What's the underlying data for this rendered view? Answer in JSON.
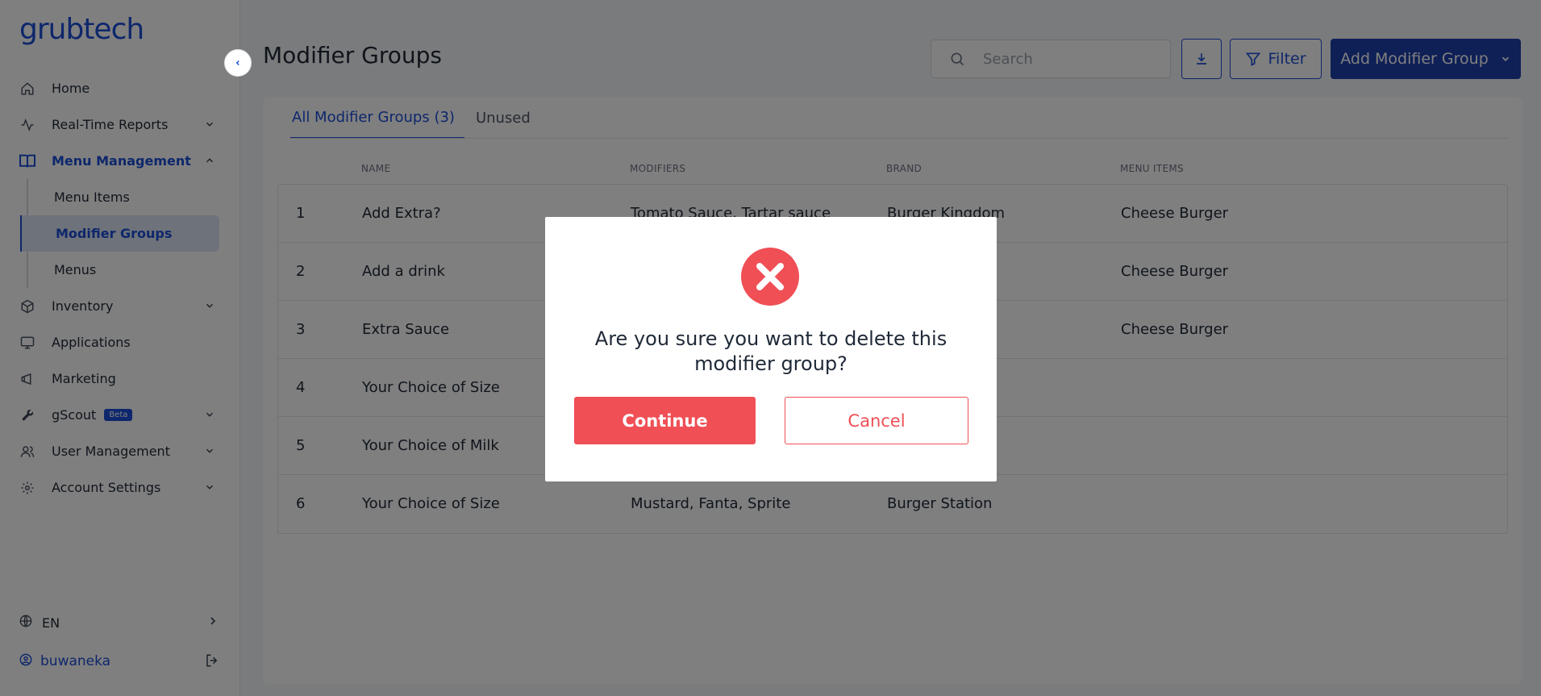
{
  "app": {
    "logo": "grubtech"
  },
  "sidebar": {
    "items": [
      {
        "label": "Home",
        "icon": "home-icon"
      },
      {
        "label": "Real-Time Reports",
        "icon": "activity-icon"
      },
      {
        "label": "Menu Management",
        "icon": "book-icon"
      },
      {
        "label": "Inventory",
        "icon": "box-icon"
      },
      {
        "label": "Applications",
        "icon": "monitor-icon"
      },
      {
        "label": "Marketing",
        "icon": "megaphone-icon"
      },
      {
        "label": "gScout",
        "icon": "wrench-icon",
        "badge": "Beta"
      },
      {
        "label": "User Management",
        "icon": "users-icon"
      },
      {
        "label": "Account Settings",
        "icon": "gear-icon"
      }
    ],
    "menu_management_sub": [
      {
        "label": "Menu Items"
      },
      {
        "label": "Modifier Groups"
      },
      {
        "label": "Menus"
      }
    ],
    "language": "EN",
    "username": "buwaneka"
  },
  "header": {
    "title": "Modifier Groups",
    "search_placeholder": "Search",
    "filter_label": "Filter",
    "add_label": "Add Modifier Group"
  },
  "tabs": [
    {
      "label": "All Modifier Groups (3)"
    },
    {
      "label": "Unused"
    }
  ],
  "table": {
    "columns": {
      "name": "NAME",
      "modifiers": "MODIFIERS",
      "brand": "BRAND",
      "menu_items": "MENU ITEMS"
    },
    "rows": [
      {
        "num": "1",
        "name": "Add Extra?",
        "modifiers": "Tomato Sauce, Tartar sauce",
        "brand": "Burger Kingdom",
        "menu_items": "Cheese Burger"
      },
      {
        "num": "2",
        "name": "Add a drink",
        "modifiers": "",
        "brand": "",
        "menu_items": "Cheese Burger"
      },
      {
        "num": "3",
        "name": "Extra Sauce",
        "modifiers": "",
        "brand": "",
        "menu_items": "Cheese Burger"
      },
      {
        "num": "4",
        "name": "Your Choice of Size",
        "modifiers": "",
        "brand": "",
        "menu_items": ""
      },
      {
        "num": "5",
        "name": "Your Choice of Milk",
        "modifiers": "",
        "brand": "",
        "menu_items": ""
      },
      {
        "num": "6",
        "name": "Your Choice of Size",
        "modifiers": "Mustard, Fanta, Sprite",
        "brand": "Burger Station",
        "menu_items": ""
      }
    ]
  },
  "modal": {
    "message": "Are you sure you want to delete this modifier group?",
    "continue_label": "Continue",
    "cancel_label": "Cancel"
  },
  "colors": {
    "brand_blue": "#1d4fd8",
    "danger": "#ef4f55"
  }
}
